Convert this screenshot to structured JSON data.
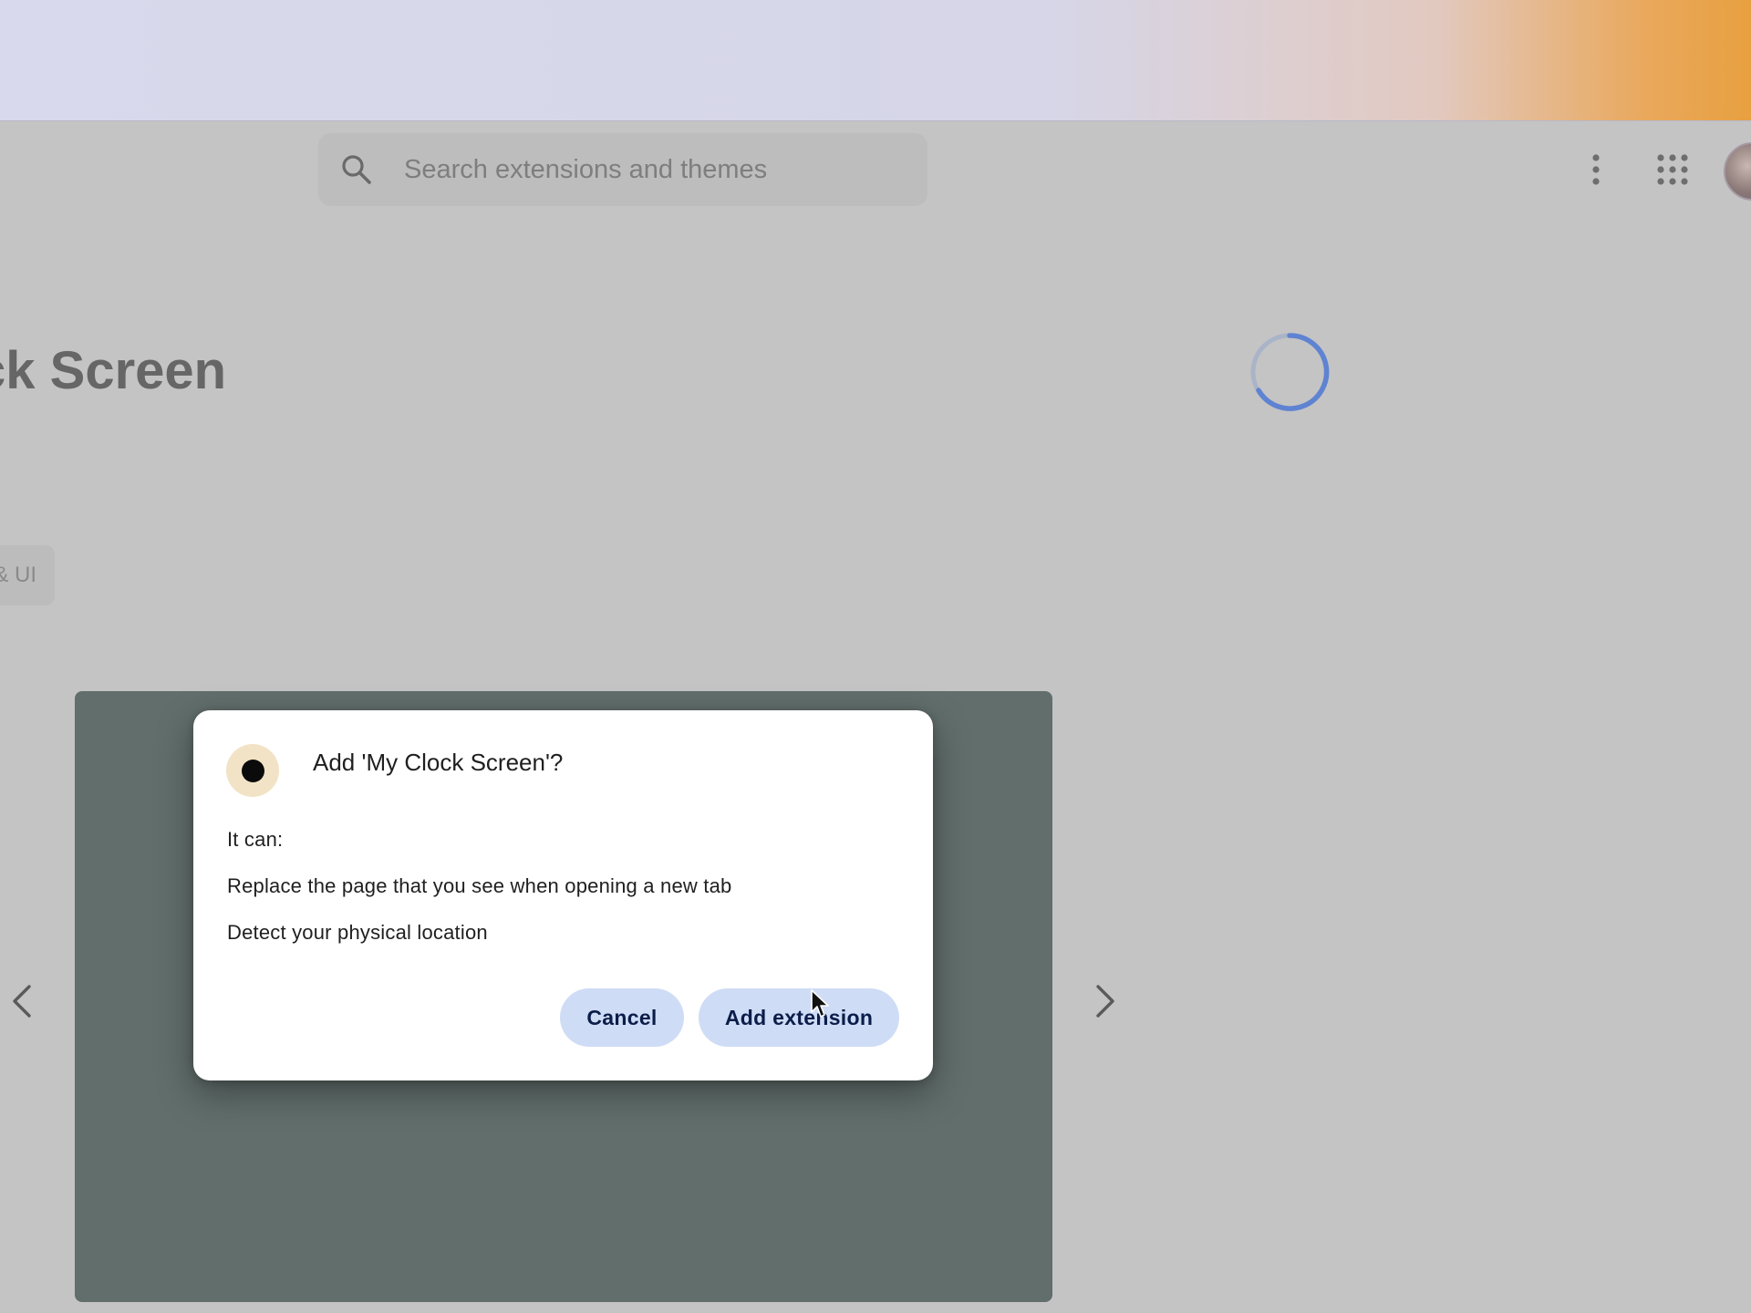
{
  "header": {
    "search_placeholder": "Search extensions and themes",
    "more_icon": "vertical-dots-icon",
    "apps_icon": "apps-grid-icon"
  },
  "listing": {
    "title": "ck Screen",
    "category_chip": "& UI"
  },
  "dialog": {
    "title": "Add 'My Clock Screen'?",
    "intro": "It can:",
    "permissions": [
      "Replace the page that you see when opening a new tab",
      "Detect your physical location"
    ],
    "cancel_label": "Cancel",
    "confirm_label": "Add extension"
  },
  "colors": {
    "page_background": "#c4c4c4",
    "carousel_panel": "#616e6b",
    "button_background": "#cfdcf6",
    "button_text": "#0b1d49",
    "spinner": "#5f83d2",
    "extension_icon_bg": "#f3e3c6"
  }
}
